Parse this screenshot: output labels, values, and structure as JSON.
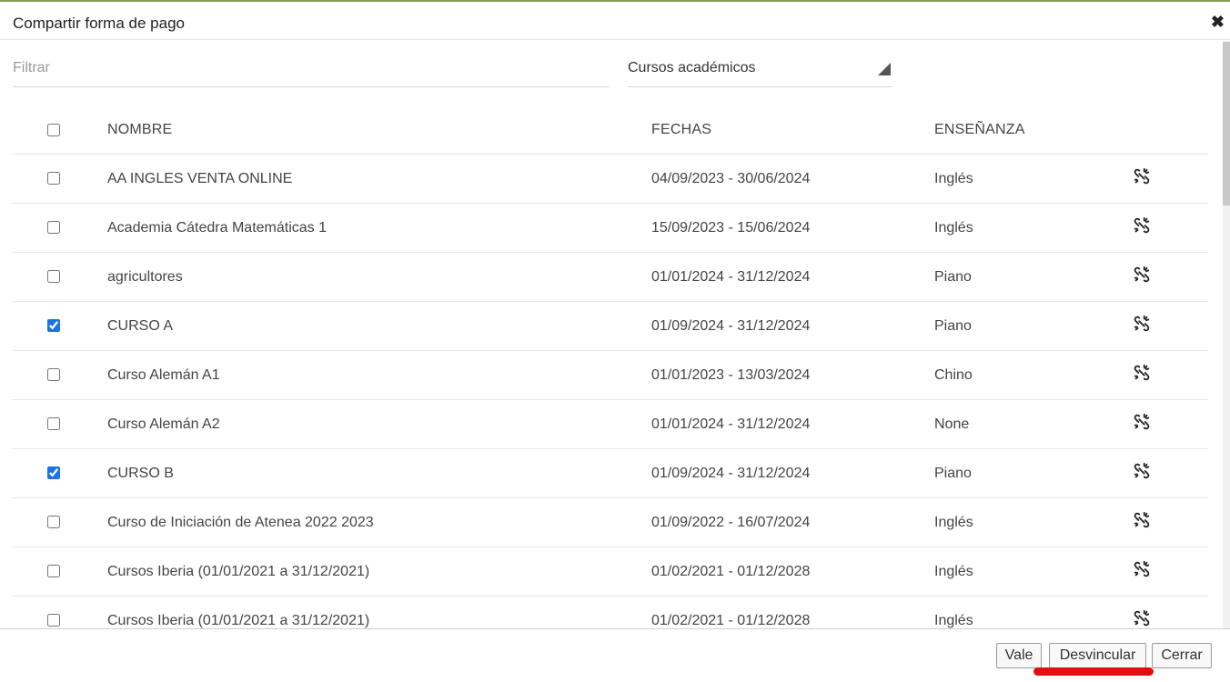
{
  "dialog": {
    "title": "Compartir forma de pago",
    "close_icon": "✖"
  },
  "filter": {
    "placeholder": "Filtrar",
    "value": ""
  },
  "select": {
    "value": "Cursos académicos"
  },
  "table": {
    "headers": {
      "name": "NOMBRE",
      "dates": "FECHAS",
      "teaching": "ENSEÑANZA"
    },
    "rows": [
      {
        "checked": false,
        "name": "AA INGLES VENTA ONLINE",
        "dates": "04/09/2023 - 30/06/2024",
        "teaching": "Inglés"
      },
      {
        "checked": false,
        "name": "Academia Cátedra Matemáticas 1",
        "dates": "15/09/2023 - 15/06/2024",
        "teaching": "Inglés"
      },
      {
        "checked": false,
        "name": "agricultores",
        "dates": "01/01/2024 - 31/12/2024",
        "teaching": "Piano"
      },
      {
        "checked": true,
        "name": "CURSO A",
        "dates": "01/09/2024 - 31/12/2024",
        "teaching": "Piano"
      },
      {
        "checked": false,
        "name": "Curso Alemán A1",
        "dates": "01/01/2023 - 13/03/2024",
        "teaching": "Chino"
      },
      {
        "checked": false,
        "name": "Curso Alemán A2",
        "dates": "01/01/2024 - 31/12/2024",
        "teaching": "None"
      },
      {
        "checked": true,
        "name": "CURSO B",
        "dates": "01/09/2024 - 31/12/2024",
        "teaching": "Piano"
      },
      {
        "checked": false,
        "name": "Curso de Iniciación de Atenea 2022 2023",
        "dates": "01/09/2022 - 16/07/2024",
        "teaching": "Inglés"
      },
      {
        "checked": false,
        "name": "Cursos Iberia (01/01/2021 a 31/12/2021)",
        "dates": "01/02/2021 - 01/12/2028",
        "teaching": "Inglés"
      },
      {
        "checked": false,
        "name": "Cursos Iberia (01/01/2021 a 31/12/2021)",
        "dates": "01/02/2021 - 01/12/2028",
        "teaching": "Inglés"
      }
    ]
  },
  "footer": {
    "ok_label": "Vale",
    "unlink_label": "Desvincular",
    "close_label": "Cerrar"
  },
  "colors": {
    "top_line": "#8a9a5b",
    "checkbox": "#1a73e8",
    "highlight": "#e01010"
  },
  "icons": {
    "row_action": "unlink-icon",
    "close": "close-icon"
  }
}
